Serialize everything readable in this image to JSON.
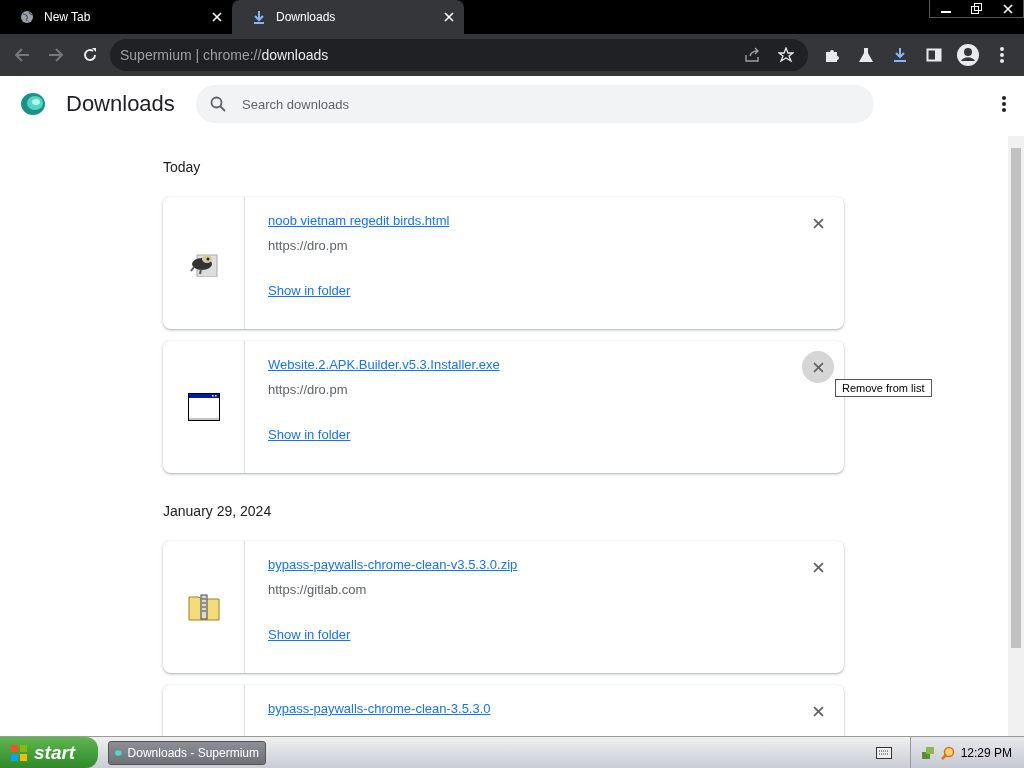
{
  "tabs": [
    {
      "title": "New Tab",
      "kind": "globe",
      "selected": false
    },
    {
      "title": "Downloads",
      "kind": "download",
      "selected": true
    }
  ],
  "address": {
    "site": "Supermium",
    "separator": "|",
    "url_prefix": "chrome://",
    "url_path": "downloads"
  },
  "header": {
    "title": "Downloads",
    "search_placeholder": "Search downloads"
  },
  "sections": [
    {
      "date": "Today",
      "items": [
        {
          "name": "noob vietnam regedit birds.html",
          "source": "https://dro.pm",
          "action": "Show in folder",
          "kind": "creature",
          "close_hovered": false
        },
        {
          "name": "Website.2.APK.Builder.v5.3.Installer.exe",
          "source": "https://dro.pm",
          "action": "Show in folder",
          "kind": "window",
          "close_hovered": true
        }
      ]
    },
    {
      "date": "January 29, 2024",
      "items": [
        {
          "name": "bypass-paywalls-chrome-clean-v3.5.3.0.zip",
          "source": "https://gitlab.com",
          "action": "Show in folder",
          "kind": "zip",
          "close_hovered": false
        },
        {
          "name": "bypass-paywalls-chrome-clean-3.5.3.0",
          "kind": "blank",
          "close_hovered": false
        }
      ]
    }
  ],
  "tooltip": "Remove from list",
  "taskbar": {
    "start": "start",
    "tasks": [
      {
        "label": "Downloads - Supermium",
        "selected": true
      }
    ],
    "clock": "12:29 PM"
  }
}
